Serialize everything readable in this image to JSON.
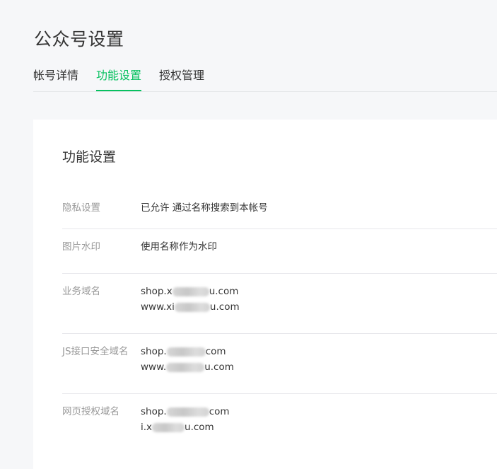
{
  "page": {
    "title": "公众号设置"
  },
  "tabs": [
    {
      "label": "帐号详情",
      "active": false
    },
    {
      "label": "功能设置",
      "active": true
    },
    {
      "label": "授权管理",
      "active": false
    }
  ],
  "colors": {
    "accent": "#07c160",
    "label": "#9a9a9a",
    "text": "#353535"
  },
  "section": {
    "title": "功能设置",
    "rows": [
      {
        "label": "隐私设置",
        "values": [
          "已允许 通过名称搜索到本帐号"
        ]
      },
      {
        "label": "图片水印",
        "values": [
          "使用名称作为水印"
        ]
      },
      {
        "label": "业务域名",
        "values": [
          {
            "prefix": "shop.x",
            "suffix": "u.com"
          },
          {
            "prefix": "www.xi",
            "suffix": "u.com"
          }
        ]
      },
      {
        "label": "JS接口安全域名",
        "values": [
          {
            "prefix": "shop.",
            "suffix": "com"
          },
          {
            "prefix": "www.",
            "suffix": "u.com"
          }
        ]
      },
      {
        "label": "网页授权域名",
        "values": [
          {
            "prefix": "shop.",
            "suffix": "com"
          },
          {
            "prefix": "i.x",
            "suffix": "u.com"
          }
        ]
      }
    ]
  }
}
